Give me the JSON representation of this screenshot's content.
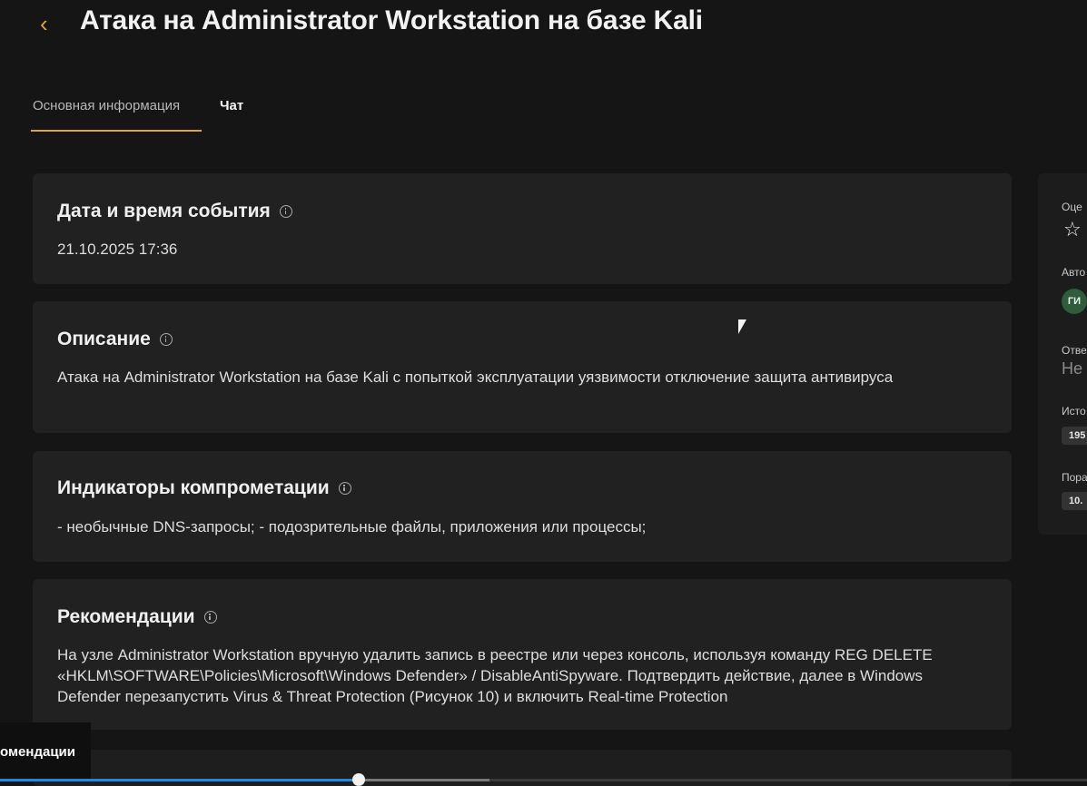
{
  "header": {
    "back_icon": "chevron-left-icon",
    "title": "Атака на Administrator Workstation на базе Kali"
  },
  "tabs": [
    {
      "label": "Основная информация",
      "active": true
    },
    {
      "label": "Чат",
      "active": false
    }
  ],
  "sections": {
    "datetime": {
      "heading": "Дата и время события",
      "value": "21.10.2025 17:36"
    },
    "description": {
      "heading": "Описание",
      "value": "Атака на Administrator Workstation на базе Kali с попыткой эксплуатации уязвимости отключение защита антивируса"
    },
    "indicators": {
      "heading": "Индикаторы компрометации",
      "value": "- необычные DNS-запросы; - подозрительные файлы, приложения или процессы;"
    },
    "recommendations": {
      "heading": "Рекомендации",
      "value": "На узле Administrator Workstation вручную удалить запись в реестре или через консоль, используя команду REG DELETE «HKLM\\SOFTWARE\\Policies\\Microsoft\\Windows Defender» / DisableAntiSpyware. Подтвердить действие, далее в Windows Defender перезапустить Virus & Threat Protection (Рисунок 10) и включить Real-time Protection"
    }
  },
  "side_panel": {
    "rating_label": "Оце",
    "rating_icon": "star-outline-icon",
    "author_label": "Авто",
    "author_initials": "ГИ",
    "responsible_label": "Отве",
    "responsible_value": "Не",
    "source_label": "Исто",
    "source_value": "195",
    "target_label": "Пора",
    "target_value": "10."
  },
  "video": {
    "tooltip": "омендации",
    "progress": 0.33,
    "buffered": 0.45
  },
  "colors": {
    "accent": "#e0a23a",
    "progress": "#1e88e5",
    "background": "#151515",
    "card": "#212121"
  }
}
